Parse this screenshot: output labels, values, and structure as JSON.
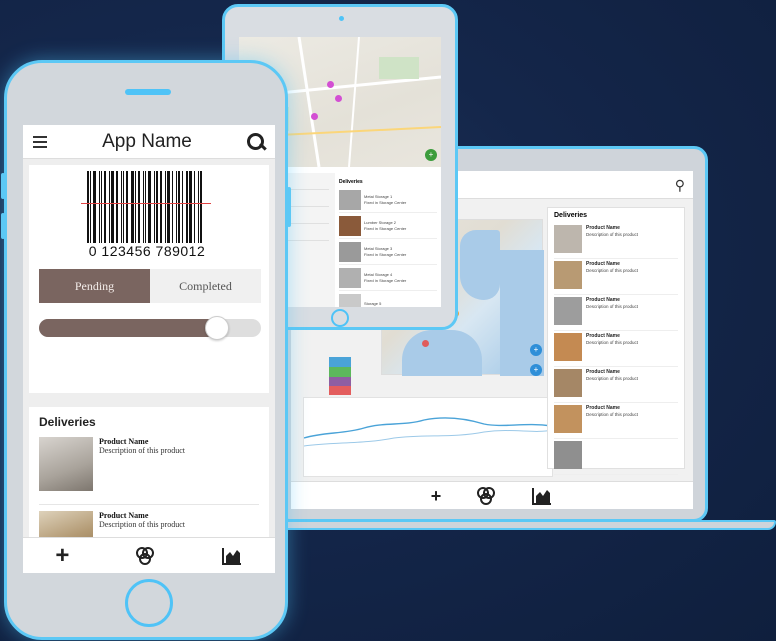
{
  "phone": {
    "app_name": "App Name",
    "barcode_number": "0 123456 789012",
    "toggle": {
      "pending_label": "Pending",
      "completed_label": "Completed",
      "selected": "Pending"
    },
    "slider": {
      "value_fraction": 0.8
    },
    "deliveries": {
      "title": "Deliveries",
      "items": [
        {
          "name": "Product Name",
          "description": "Description of this product",
          "thumb_color": "#b8b2aa"
        },
        {
          "name": "Product Name",
          "description": "Description of this product",
          "thumb_color": "#a88f6e"
        }
      ]
    },
    "tabbar": {
      "icons": [
        "plus-icon",
        "boxes-icon",
        "chart-icon"
      ]
    }
  },
  "tablet": {
    "list": {
      "title": "Deliveries",
      "items": [
        {
          "name": "Metal Storage 1",
          "description": "Fixed in Storage Center"
        },
        {
          "name": "Lumber Storage 2",
          "description": "Fixed in Storage Center"
        },
        {
          "name": "Metal Storage 3",
          "description": "Fixed in Storage Center"
        },
        {
          "name": "Metal Storage 4",
          "description": "Fixed in Storage Center"
        },
        {
          "name": "Storage 5",
          "description": ""
        }
      ]
    }
  },
  "laptop": {
    "deliveries": {
      "title": "Deliveries",
      "items": [
        {
          "name": "Product Name",
          "description": "Description of this product"
        },
        {
          "name": "Product Name",
          "description": "Description of this product"
        },
        {
          "name": "Product Name",
          "description": "Description of this product"
        },
        {
          "name": "Product Name",
          "description": "Description of this product"
        },
        {
          "name": "Product Name",
          "description": "Description of this product"
        },
        {
          "name": "Product Name",
          "description": "Description of this product"
        },
        {
          "name": "",
          "description": ""
        }
      ]
    },
    "mini_chart_colors": [
      "#4aa3d8",
      "#5cb85c",
      "#8e5ea2",
      "#e35d5d"
    ],
    "line_color": "#4aa3d8"
  },
  "colors": {
    "accent": "#4fc3f7",
    "brand_brown": "#7a6560",
    "background": "#14264a"
  }
}
